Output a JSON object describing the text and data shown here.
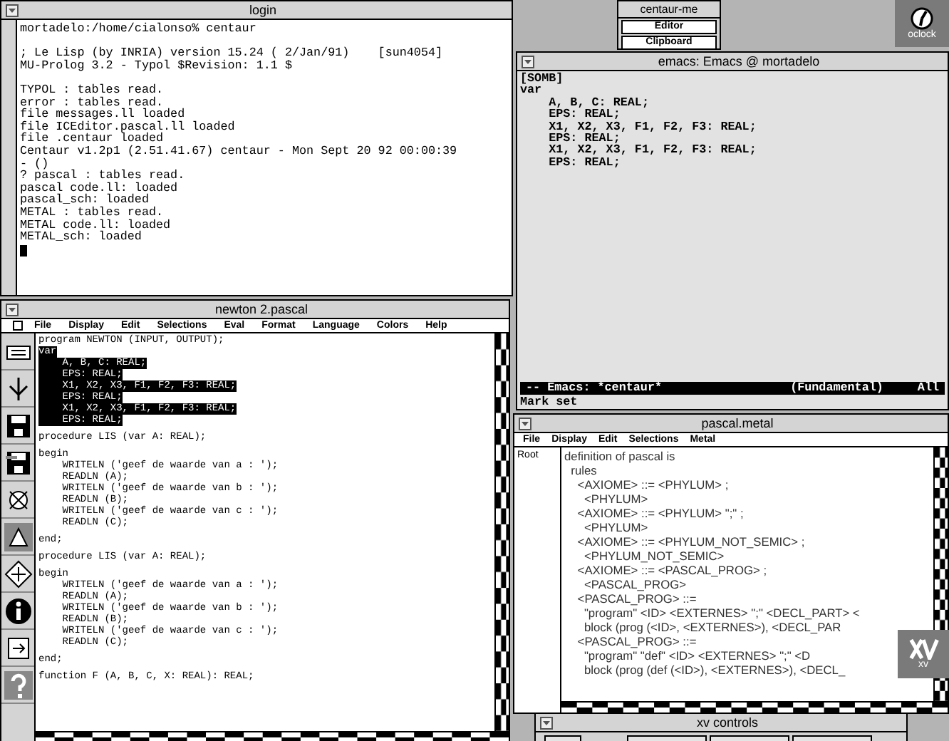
{
  "login_window": {
    "title": "login",
    "lines": [
      {
        "text": "mortadelo:/home/cialonso% centaur",
        "blank_before": false
      },
      {
        "text": "; Le Lisp (by INRIA) version 15.24 ( 2/Jan/91)    [sun4054]",
        "blank_before": true
      },
      {
        "text": "MU-Prolog 3.2 - Typol $Revision: 1.1 $",
        "blank_before": false
      },
      {
        "text": "TYPOL : tables read.",
        "blank_before": true
      },
      {
        "text": "error : tables read.",
        "blank_before": false
      },
      {
        "text": "file messages.ll loaded",
        "blank_before": false
      },
      {
        "text": "file ICEditor.pascal.ll loaded",
        "blank_before": false
      },
      {
        "text": "file .centaur loaded",
        "blank_before": false
      },
      {
        "text": "Centaur v1.2p1 (2.51.41.67) centaur - Mon Sept 20 92 00:00:39",
        "blank_before": false
      },
      {
        "text": "- ()",
        "blank_before": false
      },
      {
        "text": "? pascal : tables read.",
        "blank_before": false
      },
      {
        "text": "pascal code.ll: loaded",
        "blank_before": false
      },
      {
        "text": "pascal_sch: loaded",
        "blank_before": false
      },
      {
        "text": "METAL : tables read.",
        "blank_before": false
      },
      {
        "text": "METAL code.ll: loaded",
        "blank_before": false
      },
      {
        "text": "METAL_sch: loaded",
        "blank_before": false
      }
    ]
  },
  "menu_window": {
    "title": "centaur-me",
    "items": [
      {
        "label": "Editor"
      },
      {
        "label": "Clipboard"
      }
    ]
  },
  "clock_icon": {
    "label": "oclock"
  },
  "emacs_window": {
    "title": "emacs: Emacs @ mortadelo",
    "lines": [
      "[SOMB]",
      "var",
      "    A, B, C: REAL;",
      "    EPS: REAL;",
      "    X1, X2, X3, F1, F2, F3: REAL;",
      "    EPS: REAL;",
      "    X1, X2, X3, F1, F2, F3: REAL;",
      "    EPS: REAL;"
    ],
    "mode_line": {
      "buffer": "-- Emacs: *centaur*",
      "mode": "(Fundamental)",
      "position": "All"
    },
    "echo": "Mark set"
  },
  "pascal_window": {
    "title": "newton 2.pascal",
    "menu": [
      "File",
      "Display",
      "Edit",
      "Selections",
      "Eval",
      "Format",
      "Language",
      "Colors",
      "Help"
    ],
    "lines": [
      {
        "text": "program NEWTON (INPUT, OUTPUT);",
        "selected": false,
        "blank_before": false
      },
      {
        "text": "var",
        "selected": true,
        "blank_before": false
      },
      {
        "text": "    A, B, C: REAL;",
        "selected": true,
        "blank_before": false
      },
      {
        "text": "    EPS: REAL;",
        "selected": true,
        "blank_before": false
      },
      {
        "text": "    X1, X2, X3, F1, F2, F3: REAL;",
        "selected": true,
        "blank_before": false
      },
      {
        "text": "    EPS: REAL;",
        "selected": true,
        "blank_before": false
      },
      {
        "text": "    X1, X2, X3, F1, F2, F3: REAL;",
        "selected": true,
        "blank_before": false
      },
      {
        "text": "    EPS: REAL;",
        "selected": true,
        "blank_before": false
      },
      {
        "text": "procedure LIS (var A: REAL);",
        "selected": false,
        "blank_before": true
      },
      {
        "text": "begin",
        "selected": false,
        "blank_before": true
      },
      {
        "text": "    WRITELN ('geef de waarde van a : ');",
        "selected": false,
        "blank_before": false
      },
      {
        "text": "    READLN (A);",
        "selected": false,
        "blank_before": false
      },
      {
        "text": "    WRITELN ('geef de waarde van b : ');",
        "selected": false,
        "blank_before": false
      },
      {
        "text": "    READLN (B);",
        "selected": false,
        "blank_before": false
      },
      {
        "text": "    WRITELN ('geef de waarde van c : ');",
        "selected": false,
        "blank_before": false
      },
      {
        "text": "    READLN (C);",
        "selected": false,
        "blank_before": false
      },
      {
        "text": "end;",
        "selected": false,
        "blank_before": true
      },
      {
        "text": "procedure LIS (var A: REAL);",
        "selected": false,
        "blank_before": true
      },
      {
        "text": "begin",
        "selected": false,
        "blank_before": true
      },
      {
        "text": "    WRITELN ('geef de waarde van a : ');",
        "selected": false,
        "blank_before": false
      },
      {
        "text": "    READLN (A);",
        "selected": false,
        "blank_before": false
      },
      {
        "text": "    WRITELN ('geef de waarde van b : ');",
        "selected": false,
        "blank_before": false
      },
      {
        "text": "    READLN (B);",
        "selected": false,
        "blank_before": false
      },
      {
        "text": "    WRITELN ('geef de waarde van c : ');",
        "selected": false,
        "blank_before": false
      },
      {
        "text": "    READLN (C);",
        "selected": false,
        "blank_before": false
      },
      {
        "text": "end;",
        "selected": false,
        "blank_before": true
      },
      {
        "text": "function F (A, B, C, X: REAL): REAL;",
        "selected": false,
        "blank_before": true
      }
    ]
  },
  "metal_window": {
    "title": "pascal.metal",
    "menu": [
      "File",
      "Display",
      "Edit",
      "Selections",
      "Metal"
    ],
    "side_label": "Root",
    "lines": [
      "definition of pascal is",
      "  rules",
      "    <AXIOME> ::= <PHYLUM> ;",
      "      <PHYLUM>",
      "    <AXIOME> ::= <PHYLUM> \";\" ;",
      "      <PHYLUM>",
      "    <AXIOME> ::= <PHYLUM_NOT_SEMIC> ;",
      "      <PHYLUM_NOT_SEMIC>",
      "    <AXIOME> ::= <PASCAL_PROG> ;",
      "      <PASCAL_PROG>",
      "    <PASCAL_PROG> ::=",
      "      \"program\" <ID> <EXTERNES> \";\" <DECL_PART> <",
      "      block (prog (<ID>, <EXTERNES>), <DECL_PAR",
      "    <PASCAL_PROG> ::=",
      "      \"program\" \"def\" <ID> <EXTERNES> \";\" <D",
      "      block (prog (def (<ID>), <EXTERNES>), <DECL_"
    ]
  },
  "xv_icon": {
    "label": "xv"
  },
  "xv_controls": {
    "title": "xv controls"
  }
}
